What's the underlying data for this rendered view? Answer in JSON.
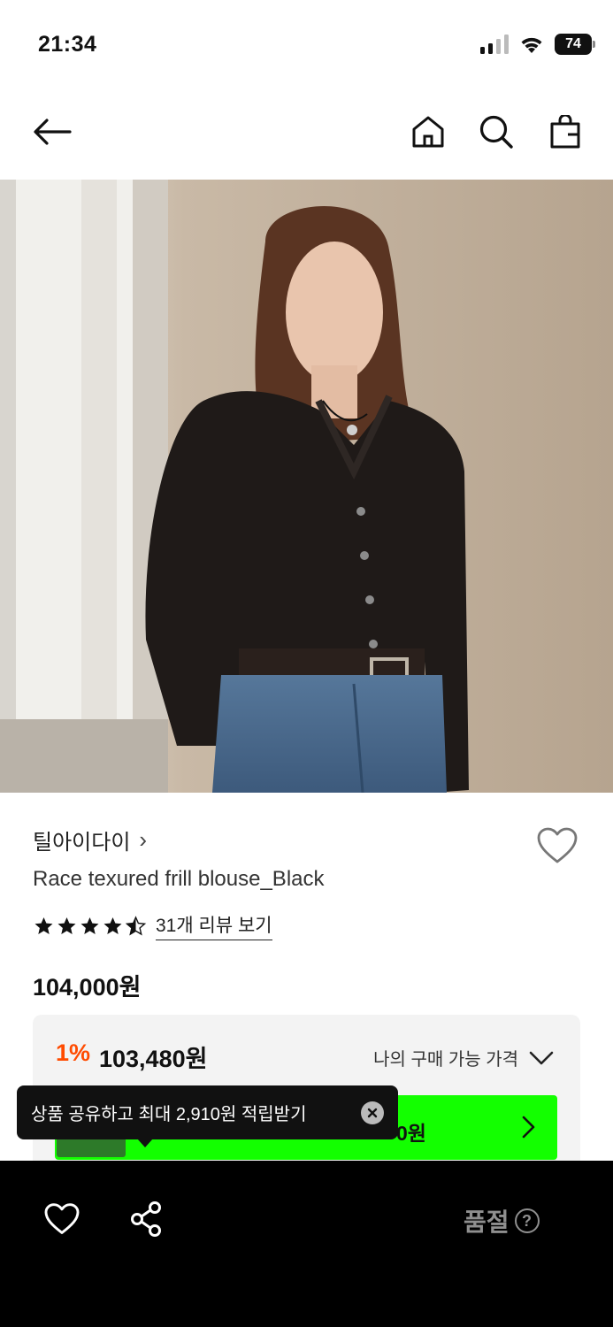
{
  "status_bar": {
    "time": "21:34",
    "battery": "74",
    "icons": [
      "signal-icon",
      "wifi-icon",
      "battery-icon"
    ]
  },
  "nav": {
    "icons": [
      "back-arrow-icon",
      "home-icon",
      "search-icon",
      "shopping-bag-icon"
    ]
  },
  "product": {
    "brand": "틸아이다이",
    "brand_chevron": "›",
    "name": "Race texured frill blouse_Black",
    "rating": 4.5,
    "review_link": "31개 리뷰 보기",
    "price": "104,000원"
  },
  "price_box": {
    "discount": "1%",
    "discounted_price": "103,480원",
    "toggle_label": "나의 구매 가능 가격"
  },
  "promo": {
    "banner_text_partial": "0원",
    "tooltip": "상품 공유하고 최대 2,910원 적립받기"
  },
  "bottom_bar": {
    "status_label": "품절",
    "help_glyph": "?"
  },
  "colors": {
    "discount": "#ff4b00",
    "promo_green": "#13ff00",
    "bottom_bar": "#000000"
  }
}
